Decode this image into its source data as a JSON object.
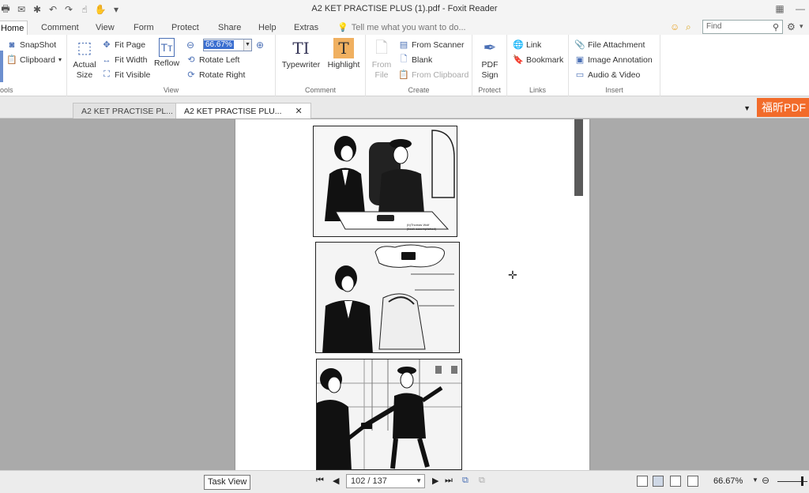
{
  "window": {
    "title": "A2 KET PRACTISE PLUS (1).pdf - Foxit Reader"
  },
  "menu": {
    "tabs": [
      "Home",
      "Comment",
      "View",
      "Form",
      "Protect",
      "Share",
      "Help",
      "Extras"
    ],
    "tell_me": "Tell me what you want to do...",
    "find_placeholder": "Find"
  },
  "ribbon": {
    "tools": {
      "snapshot": "SnapShot",
      "clipboard": "Clipboard",
      "group": "ools"
    },
    "view": {
      "actual_size": "Actual Size",
      "fit_page": "Fit Page",
      "fit_width": "Fit Width",
      "fit_visible": "Fit Visible",
      "reflow": "Reflow",
      "zoom": "66.67%",
      "rotate_left": "Rotate Left",
      "rotate_right": "Rotate Right",
      "group": "View"
    },
    "comment": {
      "typewriter": "Typewriter",
      "highlight": "Highlight",
      "group": "Comment"
    },
    "create": {
      "from_file": "From File",
      "from_scanner": "From Scanner",
      "blank": "Blank",
      "from_clipboard": "From Clipboard",
      "group": "Create"
    },
    "protect": {
      "pdf_sign": "PDF Sign",
      "group": "Protect"
    },
    "links": {
      "link": "Link",
      "bookmark": "Bookmark",
      "group": "Links"
    },
    "insert": {
      "file_attachment": "File Attachment",
      "image_annotation": "Image Annotation",
      "audio_video": "Audio & Video",
      "group": "Insert"
    }
  },
  "doc_tabs": [
    "A2 KET PRACTISE PL...",
    "A2 KET PRACTISE PLU..."
  ],
  "brand": "福昕PDF",
  "comic": {
    "caption_line1": "(b)Thomas Wolf",
    "caption_line2": "(book accomplished)"
  },
  "status": {
    "tooltip": "Task View",
    "page": "102 / 137",
    "zoom": "66.67%"
  }
}
